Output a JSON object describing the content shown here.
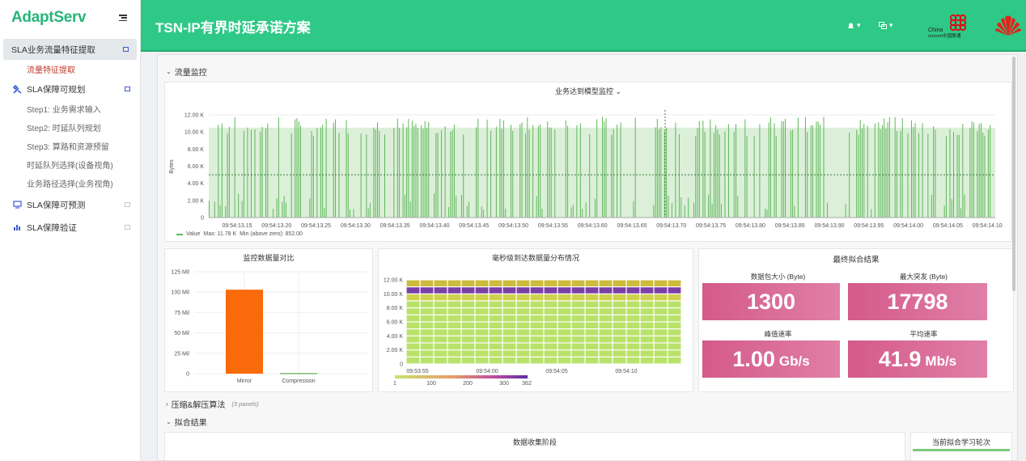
{
  "sidebar": {
    "brand": "AdaptServ",
    "items": [
      {
        "label": "SLA业务流量特征提取"
      },
      {
        "label": "流量特征提取"
      },
      {
        "label": "SLA保障可规划"
      },
      {
        "label": "Step1: 业务需求输入"
      },
      {
        "label": "Step2: 时延队列规划"
      },
      {
        "label": "Step3: 算路和资源预留"
      },
      {
        "label": "时延队列选择(设备视角)"
      },
      {
        "label": "业务路径选择(业务视角)"
      },
      {
        "label": "SLA保障可预测"
      },
      {
        "label": "SLA保障验证"
      }
    ]
  },
  "header": {
    "title": "TSN-IP有界时延承诺方案",
    "icons": [
      "bell-icon",
      "screens-icon"
    ],
    "logos": {
      "china_unicom": {
        "line1": "China",
        "line2": "unicom中国联通",
        "color": "#e60012"
      },
      "huawei_color": "#e2231a"
    }
  },
  "rows": {
    "traffic": "流量监控",
    "compression": "压缩&解压算法",
    "compression_note": "(3 panels)",
    "fitting": "拟合结果"
  },
  "arrival_panel": {
    "title": "业务达到模型监控",
    "ylabel": "Bytes",
    "y_ticks": [
      "0",
      "2.00 K",
      "4.00 K",
      "6.00 K",
      "8.00 K",
      "10.00 K",
      "12.00 K"
    ],
    "x_ticks": [
      "09:54:13.15",
      "09:54:13.20",
      "09:54:13.25",
      "09:54:13.30",
      "09:54:13.35",
      "09:54:13.40",
      "09:54:13.45",
      "09:54:13.50",
      "09:54:13.55",
      "09:54:13.60",
      "09:54:13.65",
      "09:54:13.70",
      "09:54:13.75",
      "09:54:13.80",
      "09:54:13.85",
      "09:54:13.90",
      "09:54:13.95",
      "09:54:14.00",
      "09:54:14.05",
      "09:54:14.10"
    ],
    "legend": {
      "series": "Value",
      "max": "Max: 11.78 K",
      "min": "Min (above zero): 852.00"
    }
  },
  "compare_panel": {
    "title": "监控数据量对比",
    "y_ticks": [
      "0",
      "25 Mil",
      "50 Mil",
      "75 Mil",
      "100 Mil",
      "125 Mil"
    ]
  },
  "heatmap_panel": {
    "title": "毫秒级到达数据量分布情况",
    "y_ticks": [
      "0",
      "2.00 K",
      "4.00 K",
      "6.00 K",
      "8.00 K",
      "10.00 K",
      "12.00 K"
    ],
    "x_ticks": [
      "09:53:55",
      "09:54:00",
      "09:54:05",
      "09:54:10"
    ],
    "scale_ticks": [
      "1",
      "100",
      "200",
      "300",
      "362"
    ]
  },
  "results_panel": {
    "title": "最终拟合结果",
    "stats": [
      {
        "label": "数据包大小 (Byte)",
        "value": "1300",
        "unit": ""
      },
      {
        "label": "最大突发 (Byte)",
        "value": "17798",
        "unit": ""
      },
      {
        "label": "峰值速率",
        "value": "1.00",
        "unit": "Gb/s"
      },
      {
        "label": "平均速率",
        "value": "41.9",
        "unit": "Mb/s"
      }
    ]
  },
  "bottom_panels": {
    "collection_title": "数据收集阶段",
    "round_title": "当前拟合学习轮次"
  },
  "chart_data": [
    {
      "type": "bar",
      "title": "业务达到模型监控",
      "ylabel": "Bytes",
      "ylim": [
        0,
        12000
      ],
      "x_range": [
        "09:54:13.13",
        "09:54:14.12"
      ],
      "threshold_line": 5000,
      "series": [
        {
          "name": "Value",
          "max": 11780,
          "min_above_zero": 852
        }
      ],
      "legend_placement": "bottom-left"
    },
    {
      "type": "bar",
      "title": "监控数据量对比",
      "categories": [
        "Mirror",
        "Compression"
      ],
      "values": [
        103000000,
        800000
      ],
      "ylim": [
        0,
        125000000
      ],
      "colors": [
        "#f96a0a",
        "#7fb870"
      ]
    },
    {
      "type": "heatmap",
      "title": "毫秒级到达数据量分布情况",
      "x_range": [
        "09:53:53",
        "09:54:14"
      ],
      "y_range": [
        0,
        12000
      ],
      "scale": [
        1,
        362
      ]
    }
  ]
}
